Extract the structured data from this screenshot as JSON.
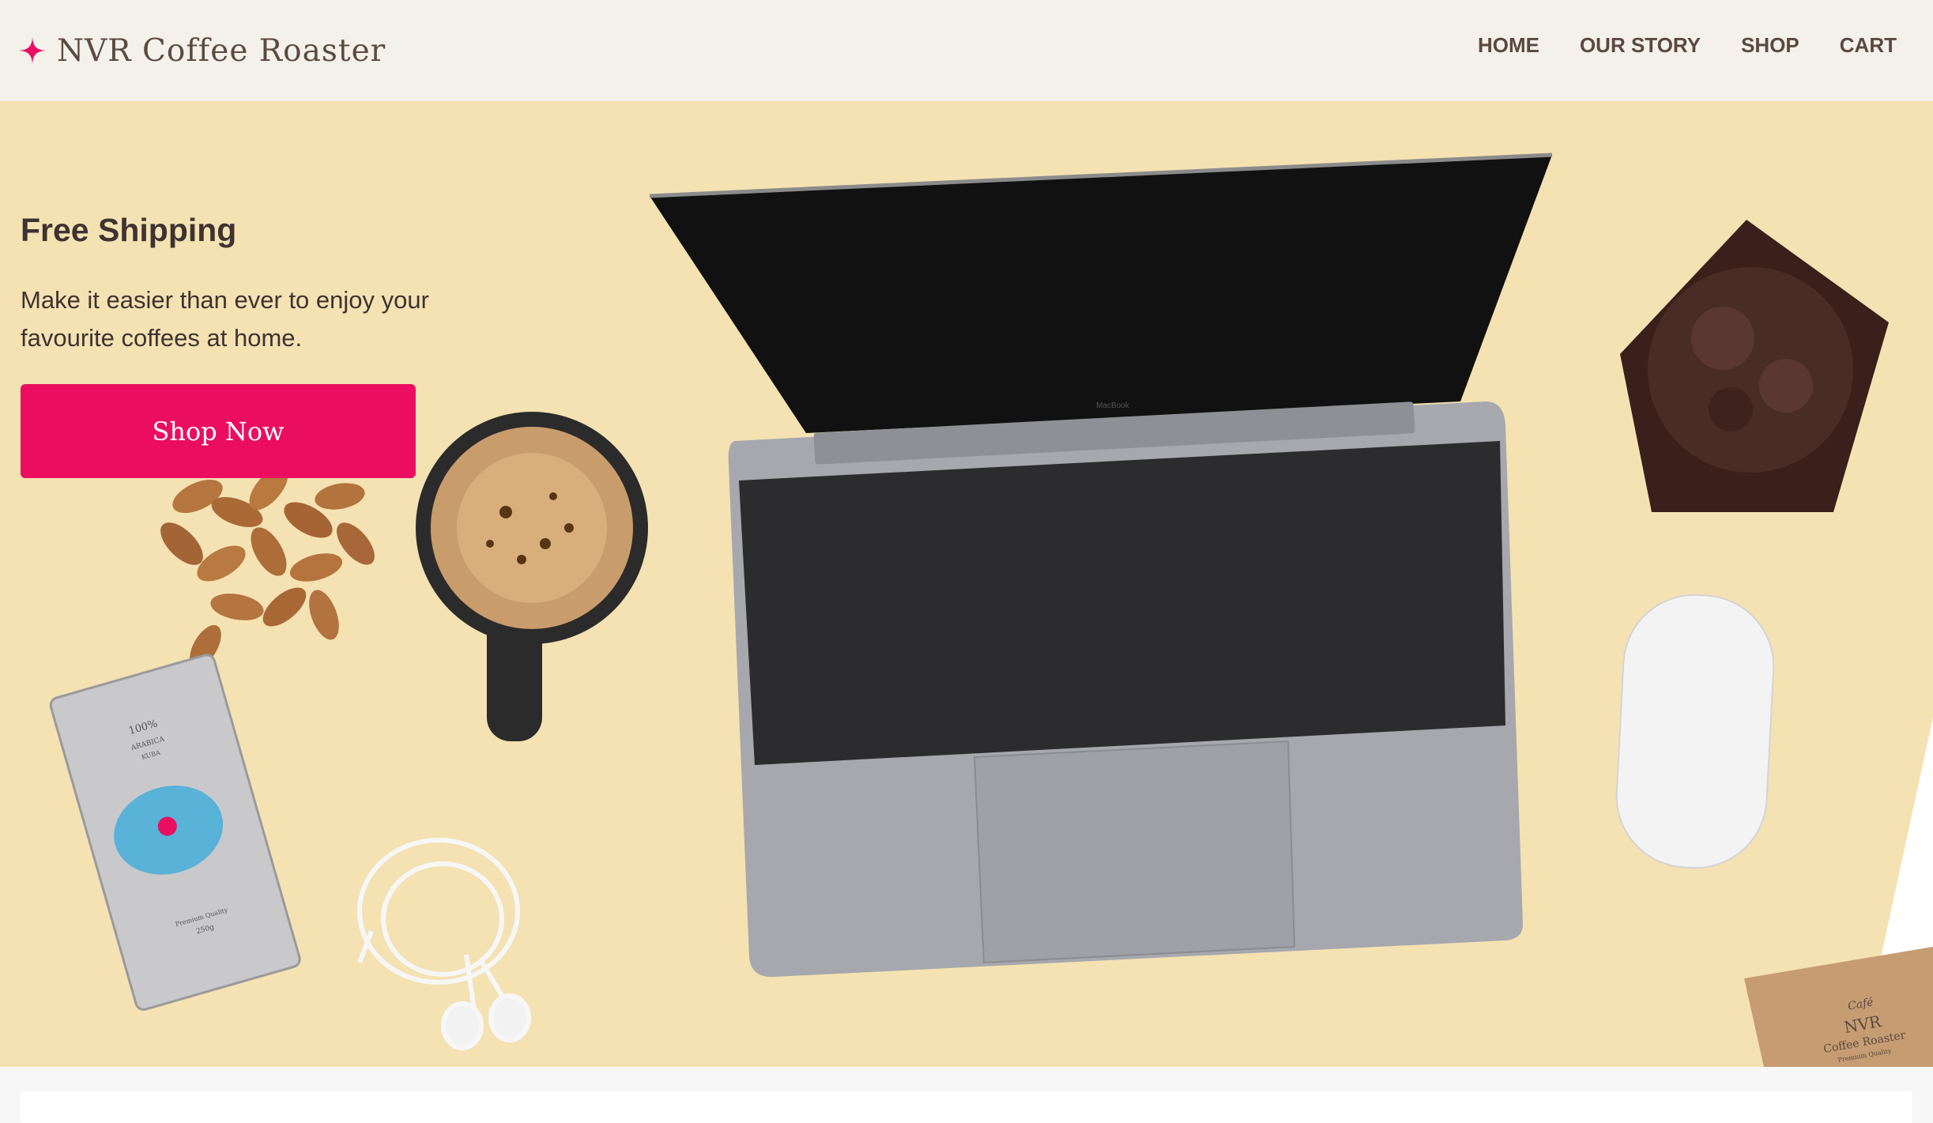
{
  "brand": {
    "name": "NVR Coffee Roaster",
    "accent": "#eb0e60",
    "logo_icon": "sparkle-star-icon"
  },
  "nav": {
    "items": [
      {
        "label": "HOME"
      },
      {
        "label": "OUR STORY"
      },
      {
        "label": "SHOP"
      },
      {
        "label": "CART"
      }
    ]
  },
  "hero": {
    "title": "Free Shipping",
    "copy": "Make it easier than ever to enjoy your favourite coffees at home.",
    "cta": "Shop Now",
    "background": "#f5e2b2"
  },
  "props": {
    "coffee_bag": {
      "line1": "100%",
      "line2": "ARABICA",
      "line3": "KUBA",
      "line4": "Premium Quality",
      "line5": "250g"
    },
    "card": {
      "line1": "Café",
      "line2": "NVR",
      "line3": "Coffee Roaster",
      "line4": "Premium Quality"
    },
    "laptop": {
      "brand": "MacBook"
    }
  }
}
